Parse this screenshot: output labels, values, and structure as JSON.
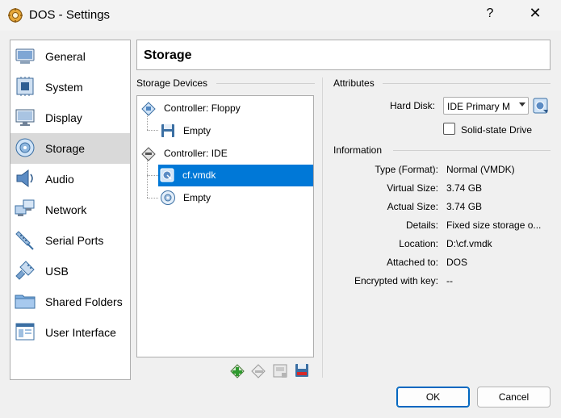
{
  "window": {
    "title": "DOS - Settings",
    "help": "?",
    "close": "✕"
  },
  "sidebar": {
    "items": [
      {
        "label": "General",
        "icon": "general-icon"
      },
      {
        "label": "System",
        "icon": "system-chip-icon"
      },
      {
        "label": "Display",
        "icon": "display-monitor-icon"
      },
      {
        "label": "Storage",
        "icon": "storage-disk-icon",
        "active": true
      },
      {
        "label": "Audio",
        "icon": "audio-speaker-icon"
      },
      {
        "label": "Network",
        "icon": "network-icon"
      },
      {
        "label": "Serial Ports",
        "icon": "serial-port-icon"
      },
      {
        "label": "USB",
        "icon": "usb-icon"
      },
      {
        "label": "Shared Folders",
        "icon": "shared-folder-icon"
      },
      {
        "label": "User Interface",
        "icon": "user-interface-icon"
      }
    ]
  },
  "header": {
    "title": "Storage"
  },
  "storage_devices": {
    "title": "Storage Devices",
    "tree": [
      {
        "label": "Controller: Floppy",
        "type": "controller",
        "icon": "floppy-controller-icon"
      },
      {
        "label": "Empty",
        "type": "attachment",
        "icon": "floppy-disk-icon"
      },
      {
        "label": "Controller: IDE",
        "type": "controller",
        "icon": "ide-controller-icon"
      },
      {
        "label": "cf.vmdk",
        "type": "attachment",
        "icon": "hard-disk-icon",
        "selected": true
      },
      {
        "label": "Empty",
        "type": "attachment",
        "icon": "optical-disc-icon"
      }
    ]
  },
  "attributes": {
    "title": "Attributes",
    "hard_disk_label": "Hard Disk:",
    "hard_disk_value": "IDE Primary M",
    "ssd_label": "Solid-state Drive",
    "ssd_checked": false
  },
  "information": {
    "title": "Information",
    "rows": [
      {
        "label": "Type (Format):",
        "value": "Normal (VMDK)"
      },
      {
        "label": "Virtual Size:",
        "value": "3.74 GB"
      },
      {
        "label": "Actual Size:",
        "value": "3.74 GB"
      },
      {
        "label": "Details:",
        "value": "Fixed size storage o..."
      },
      {
        "label": "Location:",
        "value": "D:\\cf.vmdk"
      },
      {
        "label": "Attached to:",
        "value": "DOS"
      },
      {
        "label": "Encrypted with key:",
        "value": "--"
      }
    ]
  },
  "buttons": {
    "ok": "OK",
    "cancel": "Cancel"
  },
  "colors": {
    "selection": "#0078d7",
    "active_sidebar": "#d9d9d9",
    "background": "#f0f0f0"
  }
}
